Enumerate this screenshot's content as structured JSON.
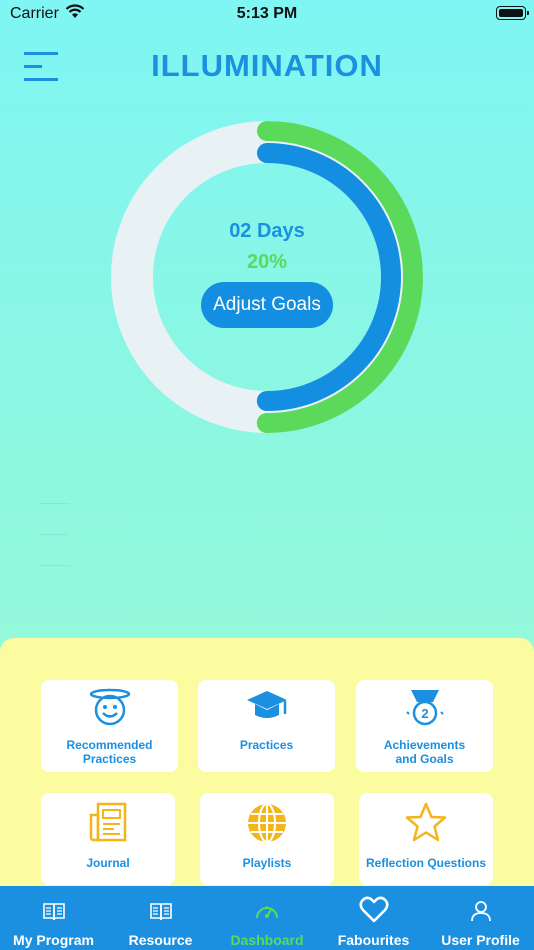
{
  "status": {
    "carrier": "Carrier",
    "time": "5:13 PM"
  },
  "header": {
    "title": "ILLUMINATION"
  },
  "progress": {
    "days": "02 Days",
    "percent_label": "20%",
    "adjust_label": "Adjust Goals",
    "outer_fraction": 0.5,
    "inner_fraction": 0.5
  },
  "colors": {
    "accent": "#1b8fe0",
    "green": "#5bd95b",
    "panel": "#fbfba0",
    "track": "#e8f2f5"
  },
  "cards": [
    {
      "label": "Recommended Practices",
      "icon": "smiley-halo-icon"
    },
    {
      "label": "Practices",
      "icon": "graduation-cap-icon"
    },
    {
      "label": "Achievements and Goals",
      "icon": "medal-icon"
    },
    {
      "label": "Journal",
      "icon": "newspaper-icon"
    },
    {
      "label": "Playlists",
      "icon": "globe-icon"
    },
    {
      "label": "Reflection Questions",
      "icon": "star-icon"
    }
  ],
  "tabs": [
    {
      "label": "My Program",
      "icon": "book-icon"
    },
    {
      "label": "Resource",
      "icon": "book-icon"
    },
    {
      "label": "Dashboard",
      "icon": "speedometer-icon"
    },
    {
      "label": "Fabourites",
      "icon": "heart-icon"
    },
    {
      "label": "User Profile",
      "icon": "person-icon"
    }
  ]
}
